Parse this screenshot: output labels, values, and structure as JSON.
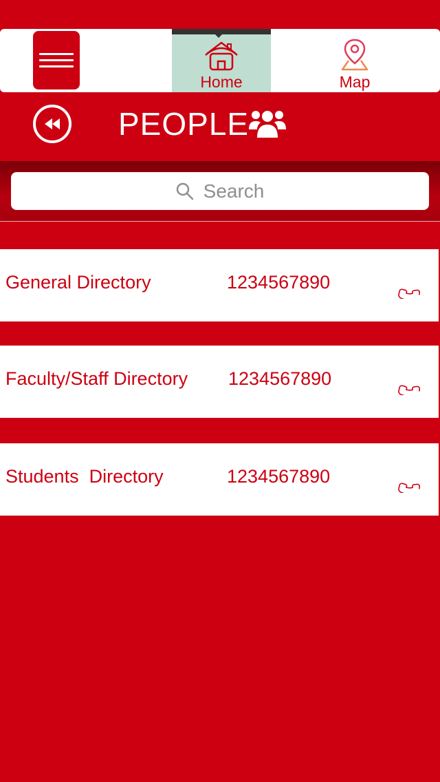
{
  "topbar": {
    "tabs": [
      {
        "label": "Home",
        "active": true
      },
      {
        "label": "Map",
        "active": false
      }
    ]
  },
  "header": {
    "title": "PEOPLE"
  },
  "search": {
    "placeholder": "Search"
  },
  "directories": [
    {
      "name": "General Directory",
      "phone": "1234567890"
    },
    {
      "name": "Faculty/Staff Directory",
      "phone": "1234567890"
    },
    {
      "name": "Students  Directory",
      "phone": "1234567890"
    }
  ],
  "colors": {
    "brand_red": "#cc0011",
    "active_tab": "#c0ddd1",
    "white": "#ffffff"
  },
  "icons": [
    "menu-icon",
    "home-icon",
    "map-pin-icon",
    "rewind-icon",
    "people-icon",
    "search-icon",
    "phone-icon"
  ]
}
